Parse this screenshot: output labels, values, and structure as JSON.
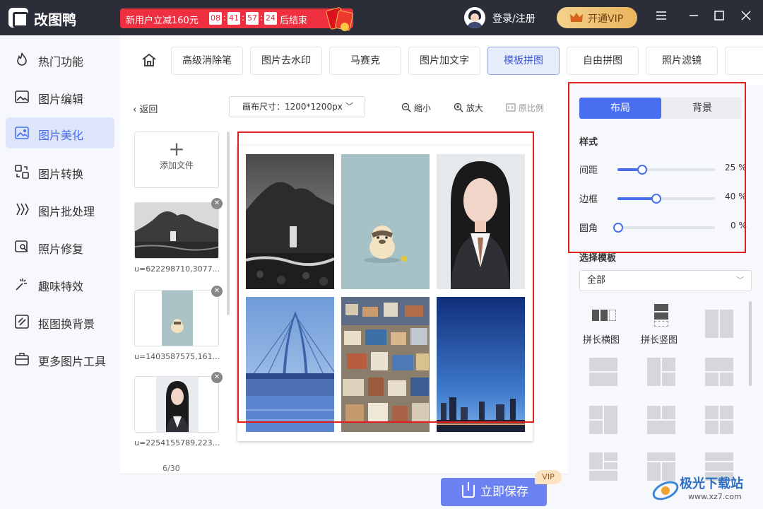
{
  "app": {
    "name": "改图鸭"
  },
  "promo": {
    "text": "新用户立减160元",
    "h": "08",
    "m": "41",
    "s": "57",
    "ms": "24",
    "suffix": "后结束"
  },
  "header": {
    "login": "登录/注册",
    "vip": "开通VIP"
  },
  "window_controls": [
    "menu-icon",
    "minimize-icon",
    "maximize-icon",
    "close-icon"
  ],
  "sidebar": {
    "items": [
      {
        "label": "热门功能",
        "icon": "fire-icon"
      },
      {
        "label": "图片编辑",
        "icon": "image-edit-icon"
      },
      {
        "label": "图片美化",
        "icon": "image-beautify-icon",
        "active": true
      },
      {
        "label": "图片转换",
        "icon": "convert-icon"
      },
      {
        "label": "图片批处理",
        "icon": "batch-icon"
      },
      {
        "label": "照片修复",
        "icon": "repair-icon"
      },
      {
        "label": "趣味特效",
        "icon": "sparkle-icon"
      },
      {
        "label": "抠图换背景",
        "icon": "cutout-icon"
      },
      {
        "label": "更多图片工具",
        "icon": "toolbox-icon"
      }
    ]
  },
  "toolbar": {
    "tools": [
      "高级消除笔",
      "图片去水印",
      "马赛克",
      "图片加文字",
      "模板拼图",
      "自由拼图",
      "照片滤镜"
    ],
    "active": "模板拼图"
  },
  "workspace": {
    "back": "返回",
    "canvas_size": "画布尺寸：1200*1200px",
    "zoom_out": "缩小",
    "zoom_in": "放大",
    "original": "原比例",
    "add_file": "添加文件",
    "files": [
      "u=622298710,3077...",
      "u=1403587575,161...",
      "u=2254155789,223..."
    ],
    "pager": "6/30",
    "save": "立即保存",
    "vip_badge": "VIP"
  },
  "panel": {
    "tabs": [
      "布局",
      "背景"
    ],
    "active_tab": "布局",
    "style_title": "样式",
    "sliders": [
      {
        "label": "间距",
        "value": 25,
        "unit": "%"
      },
      {
        "label": "边框",
        "value": 40,
        "unit": "%"
      },
      {
        "label": "圆角",
        "value": 0,
        "unit": "%"
      }
    ],
    "template_title": "选择模板",
    "template_filter": "全部",
    "template_labels": [
      "拼长横图",
      "拼长竖图"
    ]
  },
  "watermark": {
    "text": "极光下载站",
    "url": "www.xz7.com"
  },
  "colors": {
    "accent": "#4a6ef0",
    "titlebar": "#2b2e38",
    "promo": "#ee2f3f",
    "highlight": "#e02020"
  }
}
